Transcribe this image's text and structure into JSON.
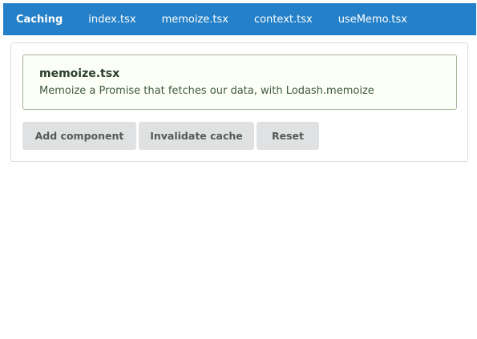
{
  "navbar": {
    "brand": "Caching",
    "links": [
      "index.tsx",
      "memoize.tsx",
      "context.tsx",
      "useMemo.tsx"
    ],
    "background_color": "#2480c8"
  },
  "message": {
    "title": "memoize.tsx",
    "text": "Memoize a Promise that fetches our data, with Lodash.memoize"
  },
  "buttons": {
    "add_component": "Add component",
    "invalidate_cache": "Invalidate cache",
    "reset": "Reset"
  }
}
